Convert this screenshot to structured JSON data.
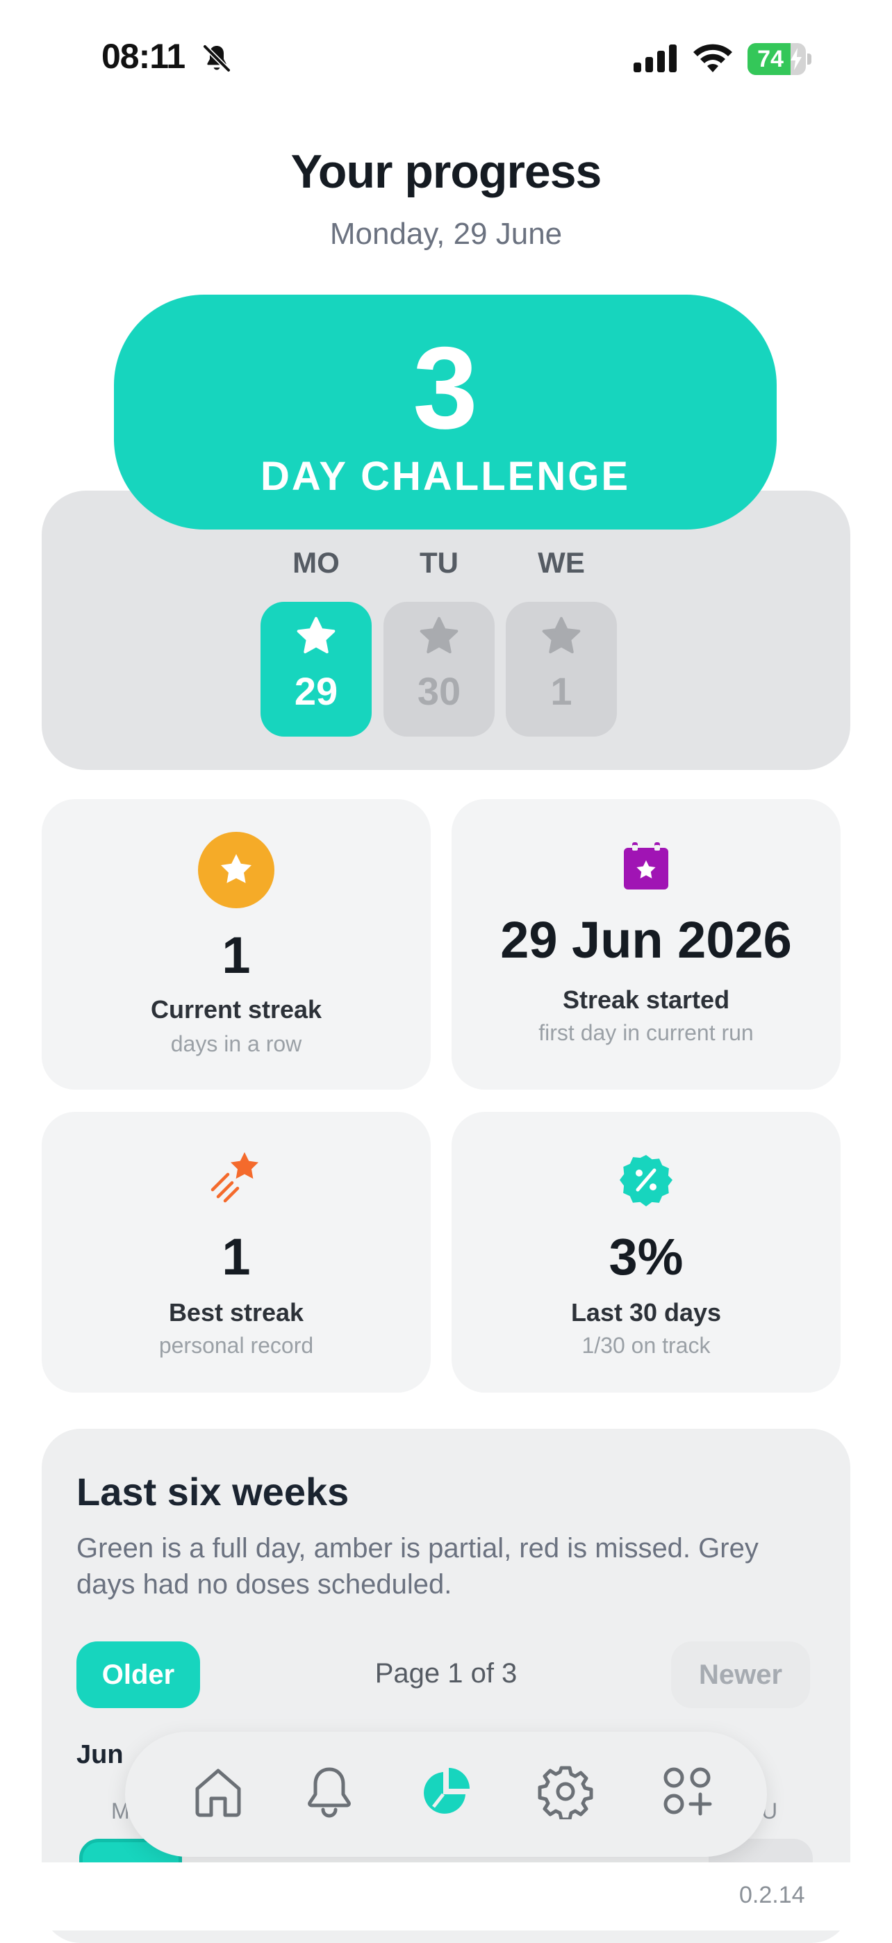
{
  "status_bar": {
    "time": "08:11",
    "battery_percent": "74",
    "battery_level": 0.74,
    "icons": [
      "bell-slash-icon",
      "cellular-signal-icon",
      "wifi-icon",
      "battery-charging-icon"
    ]
  },
  "header": {
    "title": "Your progress",
    "date": "Monday, 29 June"
  },
  "challenge": {
    "count": "3",
    "label": "DAY CHALLENGE",
    "accent_color": "#17d5be",
    "days": [
      {
        "label": "MO",
        "date": "29",
        "completed": true
      },
      {
        "label": "TU",
        "date": "30",
        "completed": false
      },
      {
        "label": "WE",
        "date": "1",
        "completed": false
      }
    ]
  },
  "stats": {
    "current_streak": {
      "icon": "star-icon",
      "value": "1",
      "label": "Current streak",
      "sub": "days in a row",
      "color": "#f5ab28"
    },
    "streak_started": {
      "icon": "calendar-star-icon",
      "value": "29 Jun 2026",
      "label": "Streak started",
      "sub": "first day in current run",
      "color": "#a014b4"
    },
    "best_streak": {
      "icon": "shooting-star-icon",
      "value": "1",
      "label": "Best streak",
      "sub": "personal record",
      "color": "#f46a2c"
    },
    "last_30_days": {
      "icon": "percent-badge-icon",
      "value": "3%",
      "label": "Last 30 days",
      "sub": "1/30 on track",
      "color": "#17d5be"
    }
  },
  "history": {
    "title": "Last six weeks",
    "description": "Green is a full day, amber is partial, red is missed. Grey days had no doses scheduled.",
    "older_label": "Older",
    "page_indicator": "Page 1 of 3",
    "newer_label": "Newer",
    "month_label": "Jun",
    "first_day_header": "M",
    "last_day_header": "U"
  },
  "nav": {
    "items": [
      {
        "name": "home-icon",
        "active": false
      },
      {
        "name": "bell-icon",
        "active": false
      },
      {
        "name": "pie-chart-icon",
        "active": true
      },
      {
        "name": "gear-icon",
        "active": false
      },
      {
        "name": "apps-add-icon",
        "active": false
      }
    ]
  },
  "footer": {
    "version": "0.2.14"
  }
}
